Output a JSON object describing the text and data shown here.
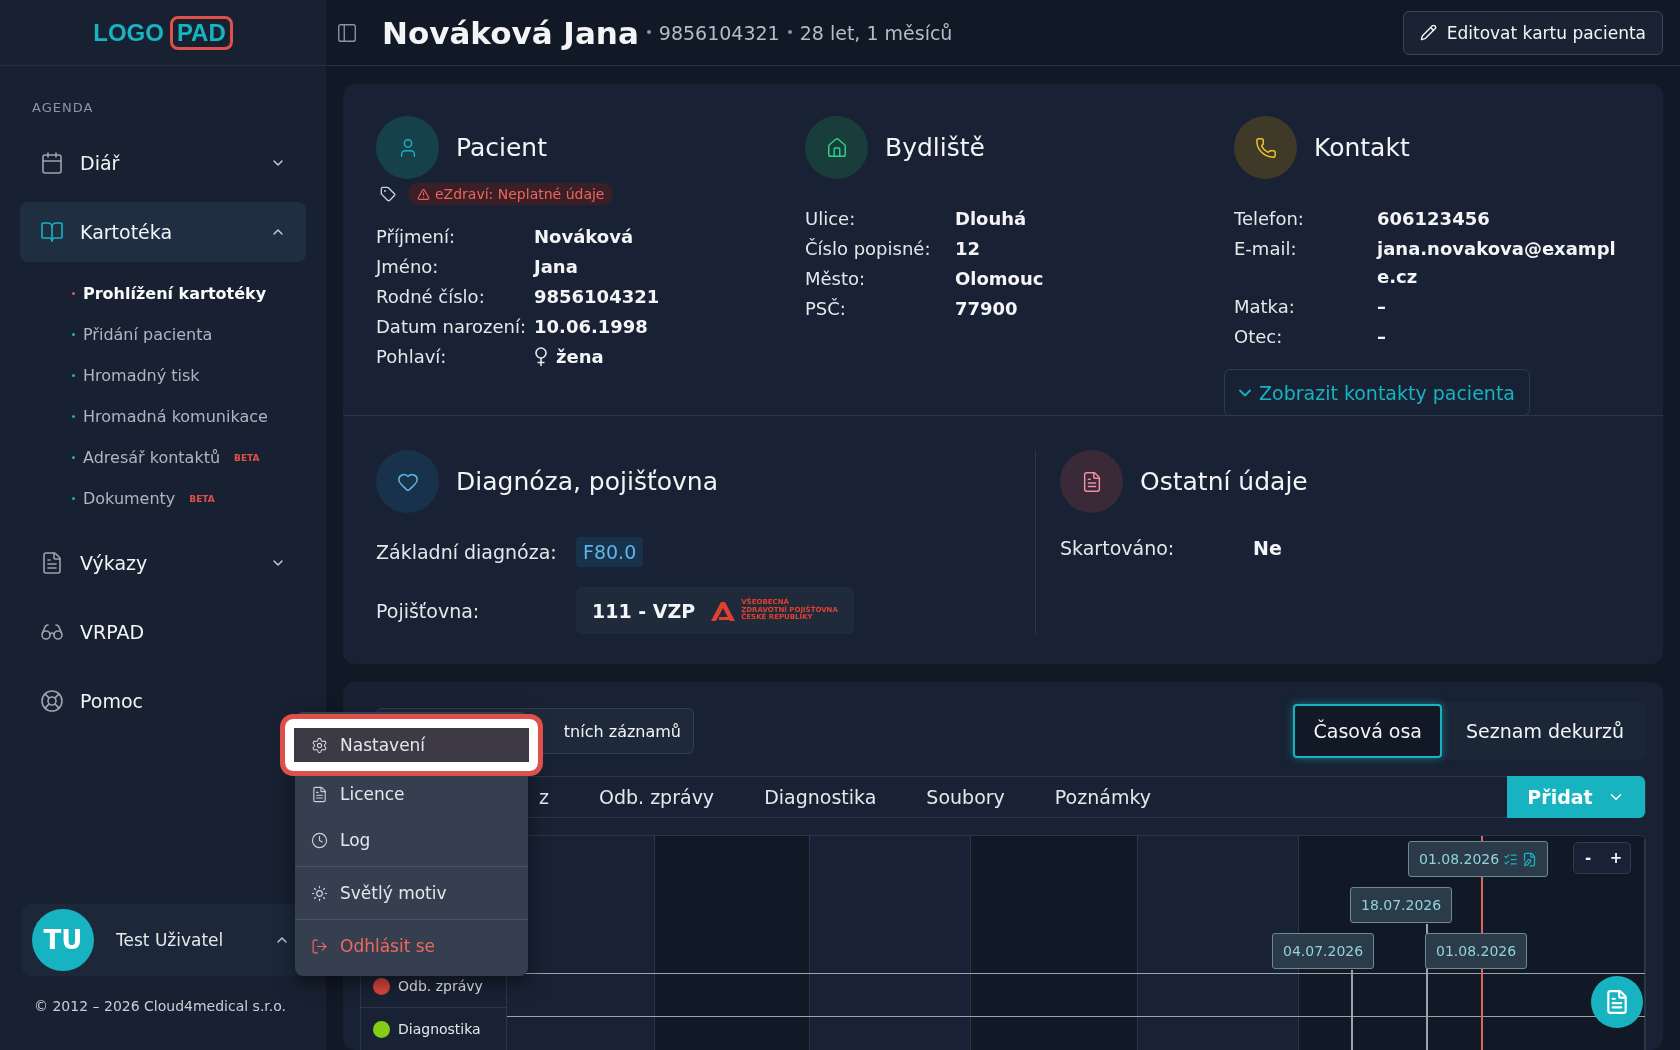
{
  "logo": {
    "word": "LOGO",
    "badge": "PAD"
  },
  "sidebar": {
    "section": "AGENDA",
    "items": [
      {
        "label": "Diář",
        "expanded": false,
        "selected": false
      },
      {
        "label": "Kartotéka",
        "expanded": true,
        "selected": true,
        "children": [
          {
            "label": "Prohlížení kartotéky",
            "selected": true
          },
          {
            "label": "Přidání pacienta",
            "selected": false
          },
          {
            "label": "Hromadný tisk",
            "selected": false
          },
          {
            "label": "Hromadná komunikace",
            "selected": false
          },
          {
            "label": "Adresář kontaktů",
            "selected": false,
            "badge": "BETA"
          },
          {
            "label": "Dokumenty",
            "selected": false,
            "badge": "BETA"
          }
        ]
      },
      {
        "label": "Výkazy",
        "expanded": false,
        "selected": false
      },
      {
        "label": "VRPAD",
        "selected": false
      },
      {
        "label": "Pomoc",
        "selected": false
      }
    ]
  },
  "user": {
    "initials": "TU",
    "name": "Test Uživatel",
    "menu_open": true
  },
  "copyright": "© 2012 – 2026 Cloud4medical s.r.o.",
  "header": {
    "title": "Nováková Jana",
    "birth_number": "9856104321",
    "age": "28 let, 1 měsíců",
    "edit_button": "Editovat kartu pacienta"
  },
  "patient": {
    "title": "Pacient",
    "warning": "eZdraví: Neplatné údaje",
    "fields": [
      {
        "label": "Příjmení:",
        "value": "Nováková"
      },
      {
        "label": "Jméno:",
        "value": "Jana"
      },
      {
        "label": "Rodné číslo:",
        "value": "9856104321"
      },
      {
        "label": "Datum narození:",
        "value": "10.06.1998"
      },
      {
        "label": "Pohlaví:",
        "value": "žena",
        "kind": "gender"
      }
    ]
  },
  "address": {
    "title": "Bydliště",
    "fields": [
      {
        "label": "Ulice:",
        "value": "Dlouhá"
      },
      {
        "label": "Číslo popisné:",
        "value": "12"
      },
      {
        "label": "Město:",
        "value": "Olomouc"
      },
      {
        "label": "PSČ:",
        "value": "77900"
      }
    ]
  },
  "contact": {
    "title": "Kontakt",
    "fields": [
      {
        "label": "Telefon:",
        "value": "606123456"
      },
      {
        "label": "E-mail:",
        "value": "jana.novakova@example.cz"
      },
      {
        "label": "Matka:",
        "value": "–"
      },
      {
        "label": "Otec:",
        "value": "–"
      }
    ],
    "show_contacts_button": "Zobrazit kontakty pacienta"
  },
  "diagnosis": {
    "title": "Diagnóza, pojišťovna",
    "diagnosis_label": "Základní diagnóza:",
    "diagnosis_code": "F80.0",
    "insurer_label": "Pojišťovna:",
    "insurer": "111 - VZP",
    "insurer_logo_text": [
      "VŠEOBECNÁ",
      "ZDRAVOTNÍ POJIŠŤOVNA",
      "ČESKÉ REPUBLIKY"
    ]
  },
  "other": {
    "title": "Ostatní údaje",
    "fields": [
      {
        "label": "Skartováno:",
        "value": "Ne"
      }
    ]
  },
  "records": {
    "filter_button": "tních záznamů",
    "views": [
      {
        "label": "Časová osa",
        "selected": true
      },
      {
        "label": "Seznam dekurzů",
        "selected": false
      }
    ],
    "tabs": [
      "z",
      "Odb. zprávy",
      "Diagnostika",
      "Soubory",
      "Poznámky"
    ],
    "add_button": "Přidat",
    "legend": [
      {
        "label": "Odb. zprávy",
        "color": "#d9473d"
      },
      {
        "label": "Diagnostika",
        "color": "#84cc16"
      }
    ],
    "markers": [
      {
        "date": "01.08.2026",
        "icons": true
      },
      {
        "date": "18.07.2026",
        "icons": false
      },
      {
        "date": "04.07.2026",
        "icons": false
      },
      {
        "date": "01.08.2026",
        "icons": false
      }
    ],
    "zoom_out": "-",
    "zoom_in": "+"
  },
  "menu": {
    "groups": [
      [
        {
          "label": "Nastavení",
          "kind": "normal",
          "highlighted": true
        },
        {
          "label": "Licence",
          "kind": "normal",
          "highlighted": false
        },
        {
          "label": "Log",
          "kind": "normal",
          "highlighted": false
        }
      ],
      [
        {
          "label": "Světlý motiv",
          "kind": "normal",
          "highlighted": false
        }
      ],
      [
        {
          "label": "Odhlásit se",
          "kind": "danger",
          "highlighted": false
        }
      ]
    ]
  }
}
